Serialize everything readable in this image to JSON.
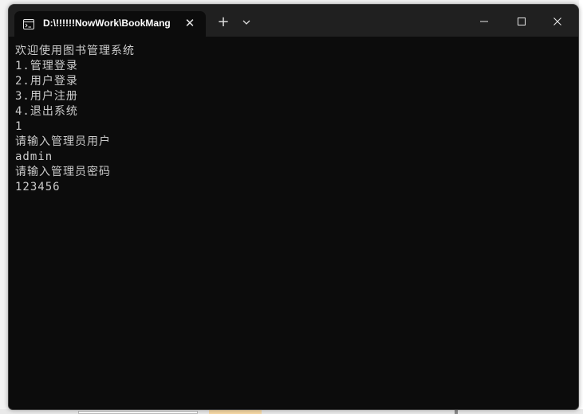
{
  "window": {
    "tab_title": "D:\\!!!!!!NowWork\\BookMang",
    "icons": {
      "tab": "terminal-icon",
      "close_tab": "close-icon",
      "new_tab": "plus-icon",
      "dropdown": "chevron-down-icon",
      "minimize": "minimize-icon",
      "maximize": "maximize-icon",
      "close_window": "close-icon"
    },
    "close_glyph": "✕",
    "new_tab_glyph": "+"
  },
  "terminal": {
    "lines": [
      "欢迎使用图书管理系统",
      "1.管理登录",
      "2.用户登录",
      "3.用户注册",
      "4.退出系统",
      "1",
      "请输入管理员用户",
      "admin",
      "请输入管理员密码",
      "123456"
    ],
    "colors": {
      "background": "#0c0c0c",
      "foreground": "#cccccc",
      "titlebar": "#202020"
    }
  }
}
